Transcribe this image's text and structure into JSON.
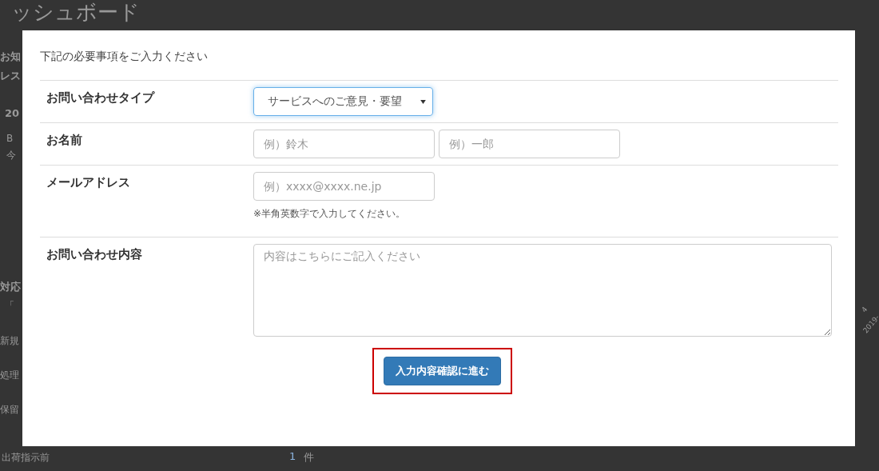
{
  "background": {
    "title": "ッシュボード",
    "texts": [
      {
        "text": "お知",
        "bold": true
      },
      {
        "text": "レス",
        "bold": true
      },
      {
        "text": "20",
        "bold": true
      },
      {
        "text": "B",
        "bold": false
      },
      {
        "text": "今",
        "bold": false
      },
      {
        "text": "対応",
        "bold": true
      },
      {
        "text": "「",
        "bold": false
      },
      {
        "text": "新規",
        "bold": false
      },
      {
        "text": "処理",
        "bold": false
      },
      {
        "text": "保留",
        "bold": false
      },
      {
        "text": "出荷指示前",
        "bold": false
      }
    ],
    "count": {
      "value": "1",
      "unit": "件"
    },
    "axis_labels": [
      "4",
      "2019-"
    ]
  },
  "modal": {
    "intro": "下記の必要事項をご入力ください",
    "rows": [
      {
        "label": "お問い合わせタイプ",
        "kind": "select",
        "value": "サービスへのご意見・要望",
        "focused": true
      },
      {
        "label": "お名前",
        "kind": "pair",
        "placeholders": [
          "例）鈴木",
          "例）一郎"
        ]
      },
      {
        "label": "メールアドレス",
        "kind": "input",
        "placeholder": "例）xxxx@xxxx.ne.jp",
        "help": "※半角英数字で入力してください。"
      },
      {
        "label": "お問い合わせ内容",
        "kind": "textarea",
        "placeholder": "内容はこちらにご記入ください"
      }
    ],
    "submit": {
      "label": "入力内容確認に進む",
      "highlighted": true
    }
  }
}
